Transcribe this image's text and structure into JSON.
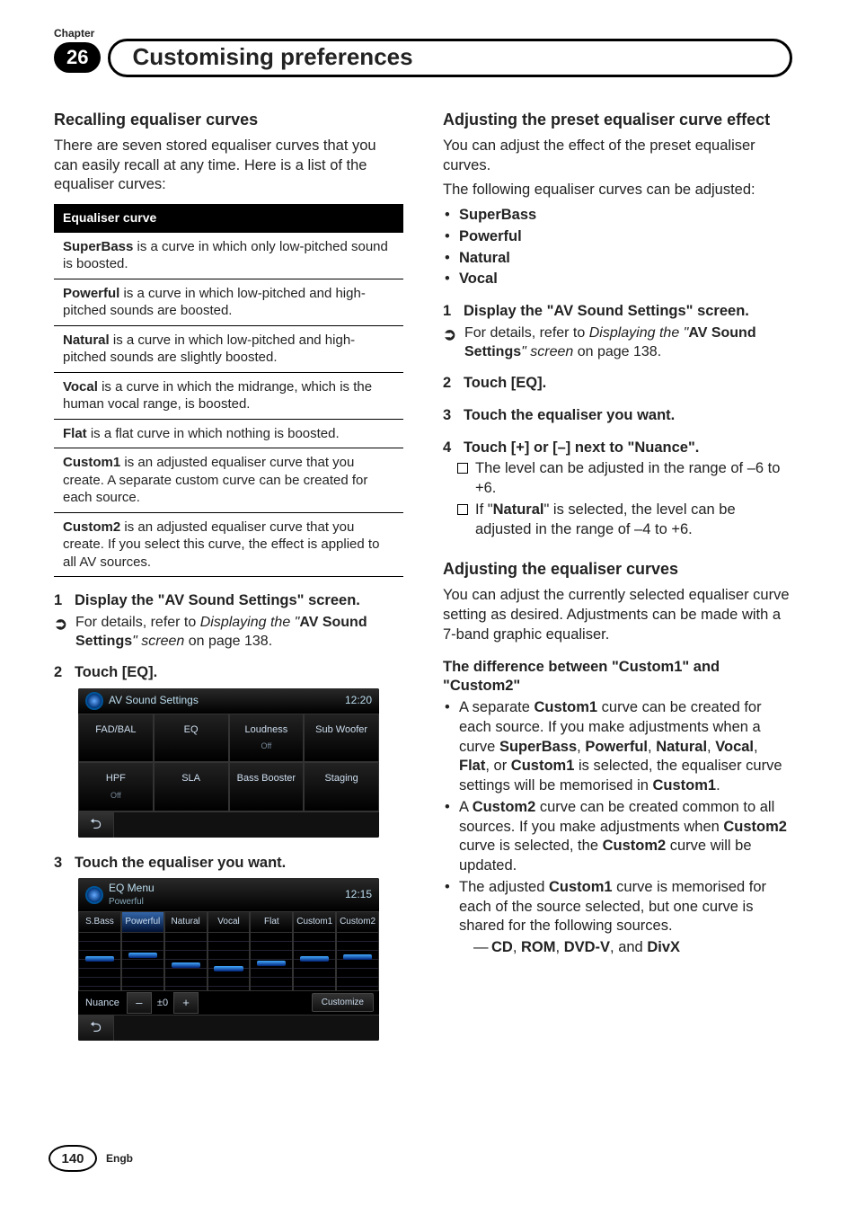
{
  "chapter": {
    "label": "Chapter",
    "number": "26",
    "title": "Customising preferences"
  },
  "left": {
    "recall_title": "Recalling equaliser curves",
    "recall_para": "There are seven stored equaliser curves that you can easily recall at any time. Here is a list of the equaliser curves:",
    "table_header": "Equaliser curve",
    "rows": [
      {
        "name": "SuperBass",
        "desc": " is a curve in which only low-pitched sound is boosted."
      },
      {
        "name": "Powerful",
        "desc": " is a curve in which low-pitched and high-pitched sounds are boosted."
      },
      {
        "name": "Natural",
        "desc": " is a curve in which low-pitched and high-pitched sounds are slightly boosted."
      },
      {
        "name": "Vocal",
        "desc": " is a curve in which the midrange, which is the human vocal range, is boosted."
      },
      {
        "name": "Flat",
        "desc": " is a flat curve in which nothing is boosted."
      },
      {
        "name": "Custom1",
        "desc": " is an adjusted equaliser curve that you create. A separate custom curve can be created for each source."
      },
      {
        "name": "Custom2",
        "desc": " is an adjusted equaliser curve that you create. If you select this curve, the effect is applied to all AV sources."
      }
    ],
    "step1_prefix": "1",
    "step1_text": "Display the \"AV Sound Settings\" screen.",
    "xref_pre": "For details, refer to ",
    "xref_i": "Displaying the \"",
    "xref_b": "AV Sound Settings",
    "xref_i2": "\" screen",
    "xref_post": " on page 138.",
    "step2_prefix": "2",
    "step2_text": "Touch [EQ].",
    "step3_prefix": "3",
    "step3_text": "Touch the equaliser you want."
  },
  "ss1": {
    "title": "AV Sound Settings",
    "time": "12:20",
    "cells": [
      {
        "t": "FAD/BAL",
        "s": ""
      },
      {
        "t": "EQ",
        "s": ""
      },
      {
        "t": "Loudness",
        "s": "Off"
      },
      {
        "t": "Sub Woofer",
        "s": ""
      },
      {
        "t": "HPF",
        "s": "Off"
      },
      {
        "t": "SLA",
        "s": ""
      },
      {
        "t": "Bass Booster",
        "s": ""
      },
      {
        "t": "Staging",
        "s": ""
      }
    ]
  },
  "ss2": {
    "title": "EQ Menu",
    "subtitle": "Powerful",
    "time": "12:15",
    "tabs": [
      "S.Bass",
      "Powerful",
      "Natural",
      "Vocal",
      "Flat",
      "Custom1",
      "Custom2"
    ],
    "nuance_label": "Nuance",
    "minus": "–",
    "val": "±0",
    "plus": "+",
    "customize": "Customize"
  },
  "right": {
    "adj_preset_title": "Adjusting the preset equaliser curve effect",
    "adj_preset_para1": "You can adjust the effect of the preset equaliser curves.",
    "adj_preset_para2": "The following equaliser curves can be adjusted:",
    "adj_list": [
      "SuperBass",
      "Powerful",
      "Natural",
      "Vocal"
    ],
    "r_step1_prefix": "1",
    "r_step1_text": "Display the \"AV Sound Settings\" screen.",
    "r_step2_prefix": "2",
    "r_step2_text": "Touch [EQ].",
    "r_step3_prefix": "3",
    "r_step3_text": "Touch the equaliser you want.",
    "r_step4_prefix": "4",
    "r_step4_text": "Touch [+] or [–] next to \"Nuance\".",
    "r_step4_note1": "The level can be adjusted in the range of –6 to +6.",
    "r_step4_note2a": "If \"",
    "r_step4_note2b": "Natural",
    "r_step4_note2c": "\" is selected, the level can be adjusted in the range of –4 to +6.",
    "adj_curves_title": "Adjusting the equaliser curves",
    "adj_curves_para": "You can adjust the currently selected equaliser curve setting as desired. Adjustments can be made with a 7-band graphic equaliser.",
    "diff_title_pre": "The difference between \"",
    "diff_title_c1": "Custom1",
    "diff_title_mid": "\" and \"",
    "diff_title_c2": "Custom2",
    "diff_title_post": "\"",
    "diff1_pre": "A separate ",
    "diff1_b1": "Custom1",
    "diff1_mid1": " curve can be created for each source. If you make adjustments when a curve ",
    "diff1_b2": "SuperBass",
    "diff1_s1": ", ",
    "diff1_b3": "Powerful",
    "diff1_s2": ", ",
    "diff1_b4": "Natural",
    "diff1_s3": ", ",
    "diff1_b5": "Vocal",
    "diff1_s4": ", ",
    "diff1_b6": "Flat",
    "diff1_s5": ", or ",
    "diff1_b7": "Custom1",
    "diff1_mid2": " is selected, the equaliser curve settings will be memorised in ",
    "diff1_b8": "Custom1",
    "diff1_post": ".",
    "diff2_pre": "A ",
    "diff2_b1": "Custom2",
    "diff2_mid1": " curve can be created common to all sources. If you make adjustments when ",
    "diff2_b2": "Custom2",
    "diff2_mid2": " curve is selected, the ",
    "diff2_b3": "Custom2",
    "diff2_post": " curve will be updated.",
    "diff3_pre": "The adjusted ",
    "diff3_b1": "Custom1",
    "diff3_post": " curve is memorised for each of the source selected, but one curve is shared for the following sources.",
    "diff3_dash_b1": "CD",
    "diff3_dash_s1": ", ",
    "diff3_dash_b2": "ROM",
    "diff3_dash_s2": ", ",
    "diff3_dash_b3": "DVD-V",
    "diff3_dash_s3": ", and ",
    "diff3_dash_b4": "DivX"
  },
  "footer": {
    "page": "140",
    "lang": "Engb"
  }
}
